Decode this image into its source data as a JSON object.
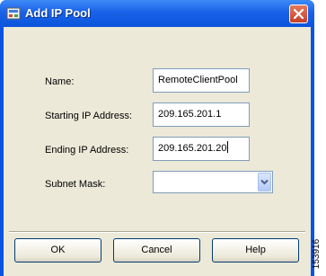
{
  "window": {
    "title": "Add IP Pool",
    "close_icon": "close-icon",
    "app_icon": "window-app-icon"
  },
  "form": {
    "name_label": "Name:",
    "name_value": "RemoteClientPool",
    "start_label": "Starting IP Address:",
    "start_value": "209.165.201.1",
    "end_label": "Ending IP Address:",
    "end_value": "209.165.201.20",
    "mask_label": "Subnet Mask:",
    "mask_value": ""
  },
  "buttons": {
    "ok": "OK",
    "cancel": "Cancel",
    "help": "Help"
  },
  "figure_id": "153916",
  "colors": {
    "titlebar": "#0a55dc",
    "client_bg": "#ece9d8",
    "field_border": "#7f9db9",
    "close_button": "#c6402a"
  }
}
